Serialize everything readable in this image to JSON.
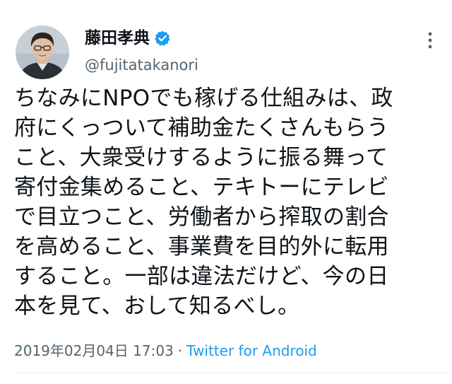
{
  "author": {
    "display_name": "藤田孝典",
    "handle": "@fujitatakanori",
    "verified": true,
    "avatar_icon": "person-photo-icon"
  },
  "tweet": {
    "lines": [
      "ちなみにNPOでも稼げる仕組みは、政",
      "府にくっついて補助金たくさんもらう",
      "こと、大衆受けするように振る舞って",
      "寄付金集めること、テキトーにテレビ",
      "で目立つこと、労働者から搾取の割合",
      "を高めること、事業費を目的外に転用",
      "すること。一部は違法だけど、今の日",
      "本を見て、おして知るべし。"
    ]
  },
  "meta": {
    "timestamp": "2019年02月04日 17:03",
    "separator": "·",
    "source": "Twitter for Android"
  },
  "colors": {
    "text": "#0f1419",
    "secondary": "#536471",
    "accent": "#1d9bf0"
  }
}
